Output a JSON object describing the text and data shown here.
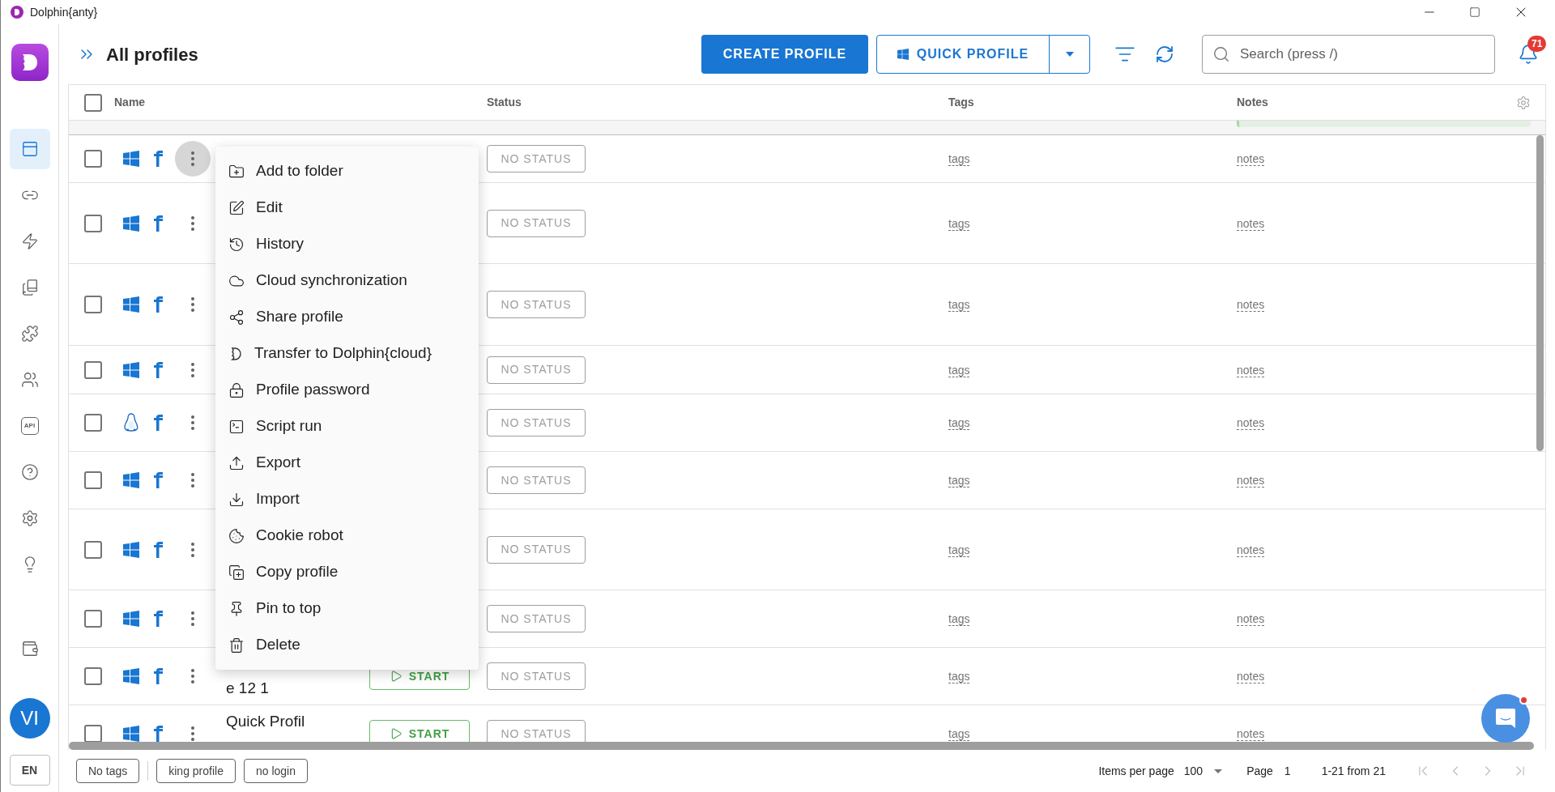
{
  "window": {
    "title": "Dolphin{anty}"
  },
  "sidebar": {
    "items": [
      {
        "selected": true
      },
      {
        "selected": false
      },
      {
        "selected": false
      },
      {
        "selected": false
      },
      {
        "selected": false
      },
      {
        "selected": false
      },
      {
        "selected": false,
        "label": "API"
      },
      {
        "selected": false
      },
      {
        "selected": false
      },
      {
        "selected": false
      }
    ],
    "avatar": "VI",
    "language": "EN"
  },
  "header": {
    "title": "All profiles",
    "create_button": "CREATE PROFILE",
    "quick_button": "QUICK PROFILE",
    "search": {
      "placeholder": "Search (press /)"
    },
    "notifications": "71"
  },
  "table": {
    "select_all": {
      "checked": false
    },
    "columns": [
      "Name",
      "Status",
      "Tags",
      "Notes"
    ],
    "rows": [
      {
        "checked": false,
        "kind": "windows",
        "menu_open": true,
        "status": "NO STATUS",
        "tags": "tags",
        "notes": "notes"
      },
      {
        "checked": false,
        "kind": "windows",
        "menu_open": false,
        "status": "NO STATUS",
        "tags": "tags",
        "notes": "notes"
      },
      {
        "checked": false,
        "kind": "windows",
        "menu_open": false,
        "status": "NO STATUS",
        "tags": "tags",
        "notes": "notes"
      },
      {
        "checked": false,
        "kind": "windows",
        "menu_open": false,
        "status": "NO STATUS",
        "tags": "tags",
        "notes": "notes"
      },
      {
        "checked": false,
        "kind": "linux",
        "menu_open": false,
        "status": "NO STATUS",
        "tags": "tags",
        "notes": "notes"
      },
      {
        "checked": false,
        "kind": "windows",
        "menu_open": false,
        "status": "NO STATUS",
        "tags": "tags",
        "notes": "notes"
      },
      {
        "checked": false,
        "kind": "windows",
        "menu_open": false,
        "status": "NO STATUS",
        "tags": "tags",
        "notes": "notes"
      },
      {
        "checked": false,
        "kind": "windows",
        "menu_open": false,
        "status": "NO STATUS",
        "tags": "tags",
        "notes": "notes"
      },
      {
        "checked": false,
        "kind": "windows",
        "menu_open": false,
        "name": "e 12 1",
        "start": "START",
        "status": "NO STATUS",
        "tags": "tags",
        "notes": "notes"
      },
      {
        "checked": false,
        "kind": "windows",
        "menu_open": false,
        "name": "Quick Profil",
        "start": "START",
        "status": "NO STATUS",
        "tags": "tags",
        "notes": "notes"
      }
    ]
  },
  "context_menu": {
    "items": [
      "Add to folder",
      "Edit",
      "History",
      "Cloud synchronization",
      "Share profile",
      "Transfer to Dolphin{cloud}",
      "Profile password",
      "Script run",
      "Export",
      "Import",
      "Cookie robot",
      "Copy profile",
      "Pin to top",
      "Delete"
    ]
  },
  "footer": {
    "tag_filters": [
      "No tags",
      "king profile",
      "no login"
    ],
    "items_per_page_label": "Items per page",
    "items_per_page": "100",
    "page_label": "Page",
    "page": "1",
    "range": "1-21 from 21"
  }
}
